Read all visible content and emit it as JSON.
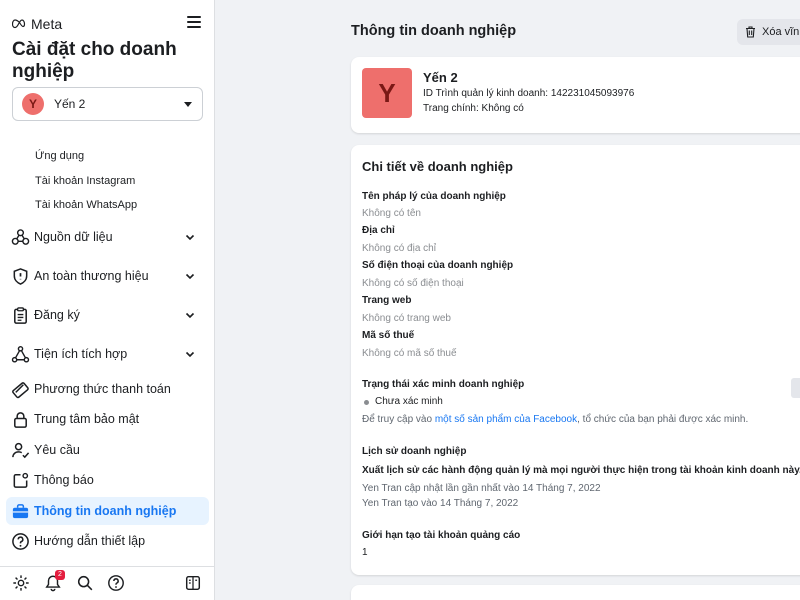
{
  "sidebar": {
    "logo": "Meta",
    "title": "Cài đặt cho doanh nghiệp",
    "account": {
      "initial": "Y",
      "name": "Yến 2"
    },
    "sub_items": [
      "Ứng dụng",
      "Tài khoản Instagram",
      "Tài khoản WhatsApp"
    ],
    "nav": [
      {
        "label": "Nguồn dữ liệu",
        "icon": "data-sources-icon",
        "expandable": true
      },
      {
        "label": "An toàn thương hiệu",
        "icon": "shield-icon",
        "expandable": true
      },
      {
        "label": "Đăng ký",
        "icon": "clipboard-icon",
        "expandable": true
      },
      {
        "label": "Tiện ích tích hợp",
        "icon": "integrations-icon",
        "expandable": true
      },
      {
        "label": "Phương thức thanh toán",
        "icon": "payment-icon",
        "expandable": false
      },
      {
        "label": "Trung tâm bảo mật",
        "icon": "lock-icon",
        "expandable": false
      },
      {
        "label": "Yêu cầu",
        "icon": "person-check-icon",
        "expandable": false
      },
      {
        "label": "Thông báo",
        "icon": "notification-icon",
        "expandable": false
      },
      {
        "label": "Thông tin doanh nghiệp",
        "icon": "briefcase-icon",
        "expandable": false,
        "active": true
      },
      {
        "label": "Hướng dẫn thiết lập",
        "icon": "help-icon",
        "expandable": false
      }
    ],
    "bottom": {
      "notification_count": "2"
    }
  },
  "main": {
    "title": "Thông tin doanh nghiệp",
    "delete_label": "Xóa vĩnh",
    "business": {
      "initial": "Y",
      "name": "Yến 2",
      "id_line": "ID Trình quản lý kinh doanh: 142231045093976",
      "main_page": "Trang chính: Không có"
    },
    "details": {
      "title": "Chi tiết về doanh nghiệp",
      "fields": [
        {
          "label": "Tên pháp lý của doanh nghiệp",
          "value": "Không có tên"
        },
        {
          "label": "Địa chỉ",
          "value": "Không có địa chỉ"
        },
        {
          "label": "Số điện thoại của doanh nghiệp",
          "value": "Không có số điện thoại"
        },
        {
          "label": "Trang web",
          "value": "Không có trang web"
        },
        {
          "label": "Mã số thuế",
          "value": "Không có mã số thuế"
        }
      ],
      "verification": {
        "label": "Trạng thái xác minh doanh nghiệp",
        "status": "Chưa xác minh",
        "note_pre": "Để truy cập vào ",
        "note_link": "một số sản phẩm của Facebook",
        "note_post": ", tổ chức của bạn phải được xác minh."
      },
      "history": {
        "label": "Lịch sử doanh nghiệp",
        "desc": "Xuất lịch sử các hành động quản lý mà mọi người thực hiện trong tài khoản kinh doanh này.",
        "updated": "Yen Tran cập nhật lần gần nhất vào 14 Tháng 7, 2022",
        "created": "Yen Tran tạo vào 14 Tháng 7, 2022"
      },
      "ad_limit": {
        "label": "Giới hạn tạo tài khoản quảng cáo",
        "value": "1"
      }
    }
  }
}
